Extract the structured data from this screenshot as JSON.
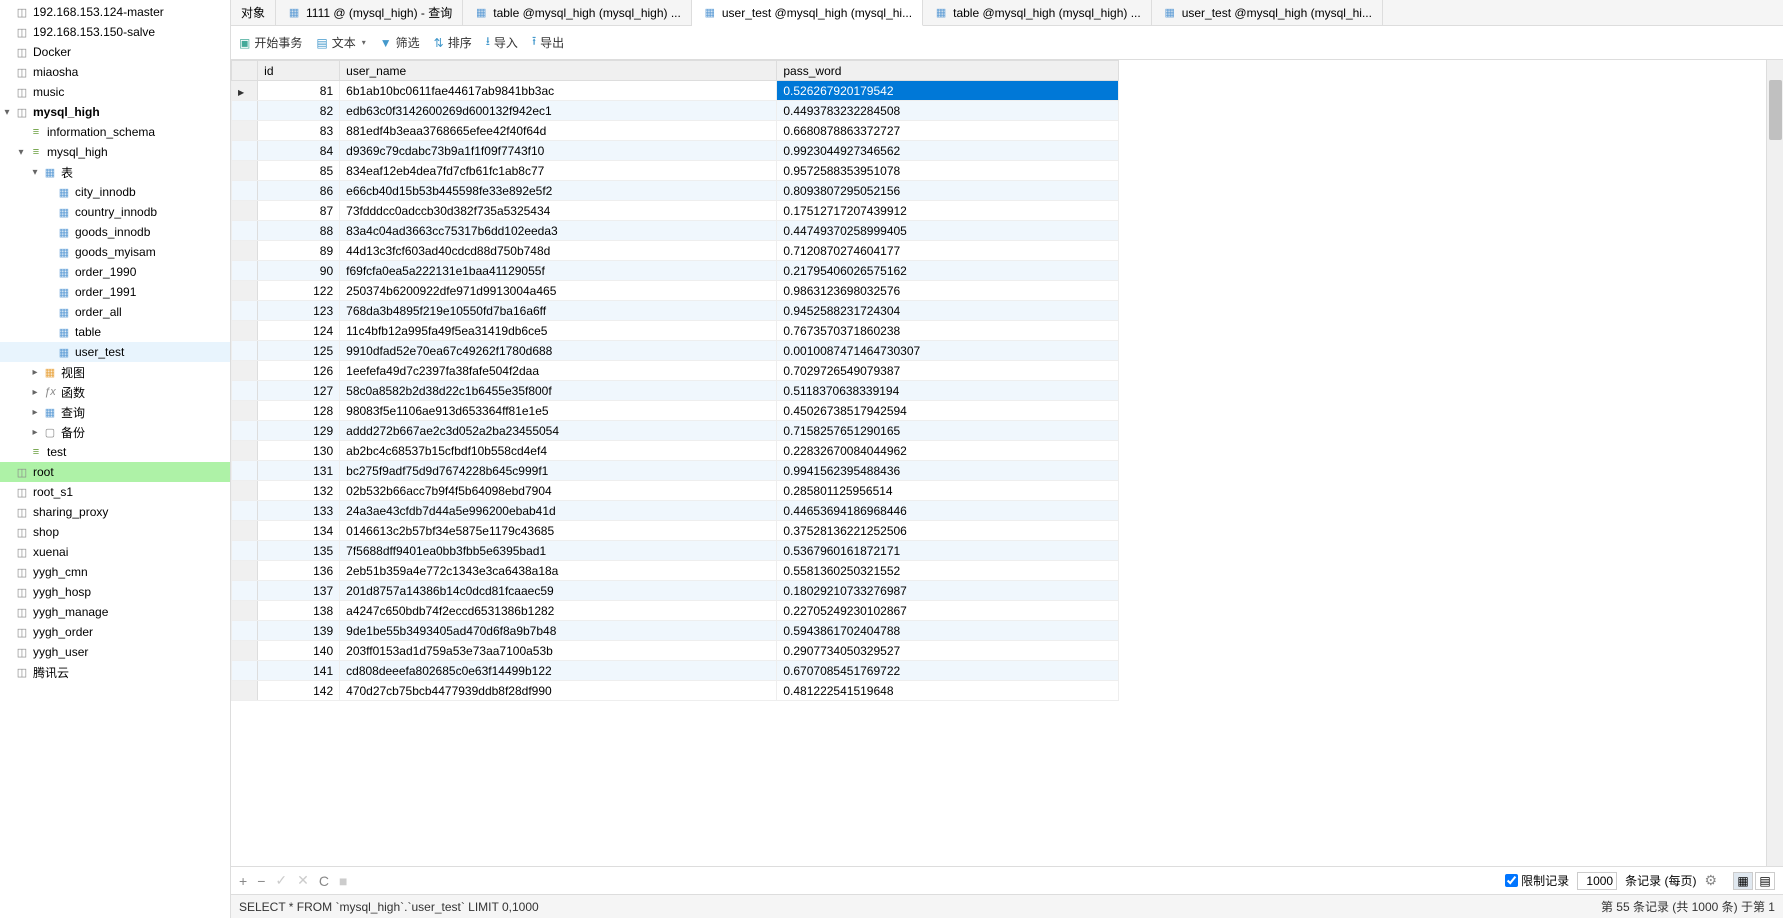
{
  "sidebar": {
    "items": [
      {
        "label": "192.168.153.124-master",
        "ind": 0,
        "icon": "db",
        "exp": ""
      },
      {
        "label": "192.168.153.150-salve",
        "ind": 0,
        "icon": "db",
        "exp": ""
      },
      {
        "label": "Docker",
        "ind": 0,
        "icon": "db",
        "exp": ""
      },
      {
        "label": "miaosha",
        "ind": 0,
        "icon": "db",
        "exp": ""
      },
      {
        "label": "music",
        "ind": 0,
        "icon": "db",
        "exp": ""
      },
      {
        "label": "mysql_high",
        "ind": 0,
        "icon": "db",
        "exp": "▾",
        "bold": true,
        "open": true
      },
      {
        "label": "information_schema",
        "ind": 1,
        "icon": "schema",
        "exp": ""
      },
      {
        "label": "mysql_high",
        "ind": 1,
        "icon": "schema",
        "exp": "▾",
        "open": true
      },
      {
        "label": "表",
        "ind": 2,
        "icon": "table",
        "exp": "▾",
        "open": true
      },
      {
        "label": "city_innodb",
        "ind": 3,
        "icon": "table",
        "exp": ""
      },
      {
        "label": "country_innodb",
        "ind": 3,
        "icon": "table",
        "exp": ""
      },
      {
        "label": "goods_innodb",
        "ind": 3,
        "icon": "table",
        "exp": ""
      },
      {
        "label": "goods_myisam",
        "ind": 3,
        "icon": "table",
        "exp": ""
      },
      {
        "label": "order_1990",
        "ind": 3,
        "icon": "table",
        "exp": ""
      },
      {
        "label": "order_1991",
        "ind": 3,
        "icon": "table",
        "exp": ""
      },
      {
        "label": "order_all",
        "ind": 3,
        "icon": "table",
        "exp": ""
      },
      {
        "label": "table",
        "ind": 3,
        "icon": "table",
        "exp": ""
      },
      {
        "label": "user_test",
        "ind": 3,
        "icon": "table",
        "exp": "",
        "hl": true
      },
      {
        "label": "视图",
        "ind": 2,
        "icon": "view",
        "exp": "▸"
      },
      {
        "label": "函数",
        "ind": 2,
        "icon": "func",
        "exp": "▸"
      },
      {
        "label": "查询",
        "ind": 2,
        "icon": "table",
        "exp": "▸"
      },
      {
        "label": "备份",
        "ind": 2,
        "icon": "folder",
        "exp": "▸"
      },
      {
        "label": "test",
        "ind": 1,
        "icon": "schema",
        "exp": ""
      },
      {
        "label": "root",
        "ind": 0,
        "icon": "db",
        "exp": "",
        "sel": true
      },
      {
        "label": "root_s1",
        "ind": 0,
        "icon": "db",
        "exp": ""
      },
      {
        "label": "sharing_proxy",
        "ind": 0,
        "icon": "db",
        "exp": ""
      },
      {
        "label": "shop",
        "ind": 0,
        "icon": "db",
        "exp": ""
      },
      {
        "label": "xuenai",
        "ind": 0,
        "icon": "db",
        "exp": ""
      },
      {
        "label": "yygh_cmn",
        "ind": 0,
        "icon": "db",
        "exp": ""
      },
      {
        "label": "yygh_hosp",
        "ind": 0,
        "icon": "db",
        "exp": ""
      },
      {
        "label": "yygh_manage",
        "ind": 0,
        "icon": "db",
        "exp": ""
      },
      {
        "label": "yygh_order",
        "ind": 0,
        "icon": "db",
        "exp": ""
      },
      {
        "label": "yygh_user",
        "ind": 0,
        "icon": "db",
        "exp": ""
      },
      {
        "label": "腾讯云",
        "ind": 0,
        "icon": "db",
        "exp": ""
      }
    ]
  },
  "tabs": [
    {
      "label": "对象",
      "icon": ""
    },
    {
      "label": "1111 @ (mysql_high) - 查询",
      "icon": "tbl"
    },
    {
      "label": "table @mysql_high (mysql_high) ...",
      "icon": "tbl"
    },
    {
      "label": "user_test @mysql_high (mysql_hi...",
      "icon": "tbl",
      "active": true
    },
    {
      "label": "table @mysql_high (mysql_high) ...",
      "icon": "tbl"
    },
    {
      "label": "user_test @mysql_high (mysql_hi...",
      "icon": "tbl"
    }
  ],
  "toolbar": {
    "begin": "开始事务",
    "text": "文本",
    "filter": "筛选",
    "sort": "排序",
    "import": "导入",
    "export": "导出"
  },
  "grid": {
    "cols": [
      "id",
      "user_name",
      "pass_word"
    ],
    "rows": [
      {
        "id": "81",
        "user": "6b1ab10bc0611fae44617ab9841bb3ac",
        "pass": "0.526267920179542",
        "cur": true
      },
      {
        "id": "82",
        "user": "edb63c0f3142600269d600132f942ec1",
        "pass": "0.4493783232284508"
      },
      {
        "id": "83",
        "user": "881edf4b3eaa3768665efee42f40f64d",
        "pass": "0.6680878863372727"
      },
      {
        "id": "84",
        "user": "d9369c79cdabc73b9a1f1f09f7743f10",
        "pass": "0.9923044927346562"
      },
      {
        "id": "85",
        "user": "834eaf12eb4dea7fd7cfb61fc1ab8c77",
        "pass": "0.9572588353951078"
      },
      {
        "id": "86",
        "user": "e66cb40d15b53b445598fe33e892e5f2",
        "pass": "0.8093807295052156"
      },
      {
        "id": "87",
        "user": "73fdddcc0adccb30d382f735a5325434",
        "pass": "0.17512717207439912"
      },
      {
        "id": "88",
        "user": "83a4c04ad3663cc75317b6dd102eeda3",
        "pass": "0.44749370258999405"
      },
      {
        "id": "89",
        "user": "44d13c3fcf603ad40cdcd88d750b748d",
        "pass": "0.7120870274604177"
      },
      {
        "id": "90",
        "user": "f69fcfa0ea5a222131e1baa41129055f",
        "pass": "0.21795406026575162"
      },
      {
        "id": "122",
        "user": "250374b6200922dfe971d9913004a465",
        "pass": "0.9863123698032576"
      },
      {
        "id": "123",
        "user": "768da3b4895f219e10550fd7ba16a6ff",
        "pass": "0.9452588231724304"
      },
      {
        "id": "124",
        "user": "11c4bfb12a995fa49f5ea31419db6ce5",
        "pass": "0.7673570371860238"
      },
      {
        "id": "125",
        "user": "9910dfad52e70ea67c49262f1780d688",
        "pass": "0.0010087471464730307"
      },
      {
        "id": "126",
        "user": "1eefefa49d7c2397fa38fafe504f2daa",
        "pass": "0.7029726549079387"
      },
      {
        "id": "127",
        "user": "58c0a8582b2d38d22c1b6455e35f800f",
        "pass": "0.5118370638339194"
      },
      {
        "id": "128",
        "user": "98083f5e1106ae913d653364ff81e1e5",
        "pass": "0.45026738517942594"
      },
      {
        "id": "129",
        "user": "addd272b667ae2c3d052a2ba23455054",
        "pass": "0.7158257651290165"
      },
      {
        "id": "130",
        "user": "ab2bc4c68537b15cfbdf10b558cd4ef4",
        "pass": "0.22832670084044962"
      },
      {
        "id": "131",
        "user": "bc275f9adf75d9d7674228b645c999f1",
        "pass": "0.9941562395488436"
      },
      {
        "id": "132",
        "user": "02b532b66acc7b9f4f5b64098ebd7904",
        "pass": "0.285801125956514"
      },
      {
        "id": "133",
        "user": "24a3ae43cfdb7d44a5e996200ebab41d",
        "pass": "0.44653694186968446"
      },
      {
        "id": "134",
        "user": "0146613c2b57bf34e5875e1179c43685",
        "pass": "0.37528136221252506"
      },
      {
        "id": "135",
        "user": "7f5688dff9401ea0bb3fbb5e6395bad1",
        "pass": "0.5367960161872171"
      },
      {
        "id": "136",
        "user": "2eb51b359a4e772c1343e3ca6438a18a",
        "pass": "0.5581360250321552"
      },
      {
        "id": "137",
        "user": "201d8757a14386b14c0dcd81fcaaec59",
        "pass": "0.18029210733276987"
      },
      {
        "id": "138",
        "user": "a4247c650bdb74f2eccd6531386b1282",
        "pass": "0.22705249230102867"
      },
      {
        "id": "139",
        "user": "9de1be55b3493405ad470d6f8a9b7b48",
        "pass": "0.5943861702404788"
      },
      {
        "id": "140",
        "user": "203ff0153ad1d759a53e73aa7100a53b",
        "pass": "0.2907734050329527"
      },
      {
        "id": "141",
        "user": "cd808deeefa802685c0e63f14499b122",
        "pass": "0.6707085451769722"
      },
      {
        "id": "142",
        "user": "470d27cb75bcb4477939ddb8f28df990",
        "pass": "0.481222541519648"
      }
    ]
  },
  "bottombar": {
    "limit_label": "限制记录",
    "limit_value": "1000",
    "records_label": "条记录 (每页)"
  },
  "status": {
    "query": "SELECT * FROM `mysql_high`.`user_test` LIMIT 0,1000",
    "info": "第 55 条记录 (共 1000 条) 于第 1"
  }
}
